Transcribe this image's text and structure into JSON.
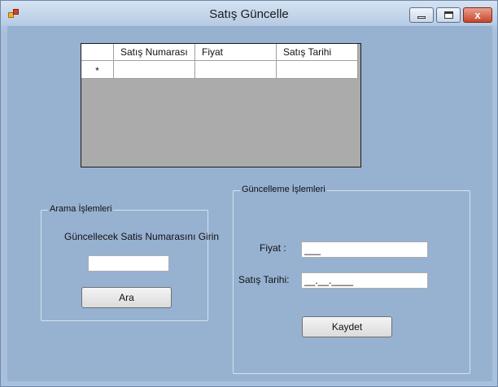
{
  "window": {
    "title": "Satış Güncelle",
    "close_glyph": "x"
  },
  "grid": {
    "columns": [
      "",
      "Satış Numarası",
      "Fiyat",
      "Satış Tarihi"
    ],
    "new_row_marker": "*"
  },
  "search_group": {
    "legend": "Arama İşlemleri",
    "prompt": "Güncellecek Satis Numarasını  Girin",
    "input_value": "",
    "button_label": "Ara"
  },
  "update_group": {
    "legend": "Güncelleme İşlemleri",
    "price_label": "Fiyat :",
    "price_value": "___",
    "date_label": "Satış Tarihi:",
    "date_value": "__.__.____",
    "button_label": "Kaydet"
  }
}
